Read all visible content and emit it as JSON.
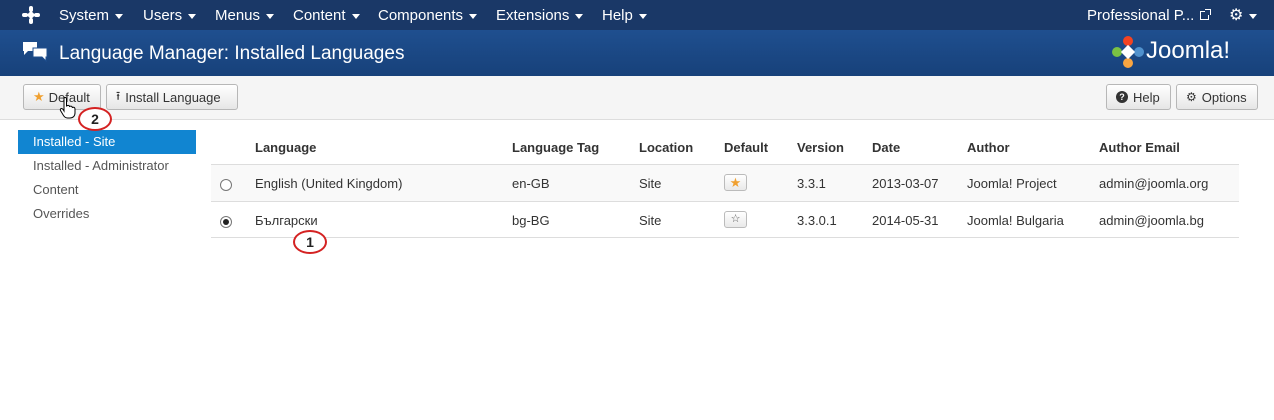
{
  "topnav": {
    "menus": [
      "System",
      "Users",
      "Menus",
      "Content",
      "Components",
      "Extensions",
      "Help"
    ],
    "site_link": "Professional P...",
    "settings_icon": "gear-icon"
  },
  "header": {
    "title": "Language Manager: Installed Languages",
    "brand": "Joomla!",
    "icon": "chat-bubbles-icon"
  },
  "toolbar": {
    "default_label": "Default",
    "install_label": "Install Language",
    "help_label": "Help",
    "options_label": "Options"
  },
  "sidebar": {
    "items": [
      {
        "label": "Installed - Site",
        "active": true
      },
      {
        "label": "Installed - Administrator",
        "active": false
      },
      {
        "label": "Content",
        "active": false
      },
      {
        "label": "Overrides",
        "active": false
      }
    ]
  },
  "table": {
    "headers": [
      "Language",
      "Language Tag",
      "Location",
      "Default",
      "Version",
      "Date",
      "Author",
      "Author Email"
    ],
    "rows": [
      {
        "selected": false,
        "language": "English (United Kingdom)",
        "tag": "en-GB",
        "location": "Site",
        "is_default": true,
        "version": "3.3.1",
        "date": "2013-03-07",
        "author": "Joomla! Project",
        "email": "admin@joomla.org"
      },
      {
        "selected": true,
        "language": "Български",
        "tag": "bg-BG",
        "location": "Site",
        "is_default": false,
        "version": "3.3.0.1",
        "date": "2014-05-31",
        "author": "Joomla! Bulgaria",
        "email": "admin@joomla.bg"
      }
    ]
  },
  "annotations": [
    "1",
    "2"
  ],
  "colors": {
    "nav_bg": "#1a3867",
    "header_bg": "#1f4f8f",
    "active_blue": "#1185d1",
    "callout_red": "#d42222",
    "star": "#f0a030"
  }
}
